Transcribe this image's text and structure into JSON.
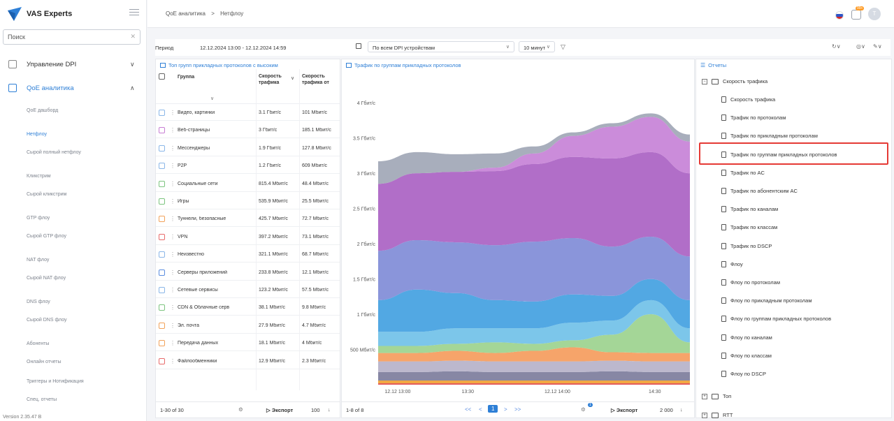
{
  "brand": {
    "name": "VAS Experts"
  },
  "search": {
    "placeholder": "Поиск"
  },
  "sidebar": {
    "sections": [
      {
        "label": "Управление DPI"
      },
      {
        "label": "QoE аналитика"
      }
    ],
    "items": [
      {
        "label": "QoE дашборд"
      },
      {
        "label": "Нетфлоу"
      },
      {
        "label": "Сырой полный нетфлоу"
      },
      {
        "label": "Кликстрим"
      },
      {
        "label": "Сырой кликстрим"
      },
      {
        "label": "GTP флоу"
      },
      {
        "label": "Сырой GTP флоу"
      },
      {
        "label": "NAT флоу"
      },
      {
        "label": "Сырой NAT флоу"
      },
      {
        "label": "DNS флоу"
      },
      {
        "label": "Сырой DNS флоу"
      },
      {
        "label": "Абоненты"
      },
      {
        "label": "Онлайн отчеты"
      },
      {
        "label": "Триггеры и Нотификация"
      },
      {
        "label": "Спец. отчеты"
      }
    ],
    "version": "Version 2.35.47 B"
  },
  "breadcrumb": {
    "root": "QoE аналитика",
    "sep": ">",
    "current": "Нетфлоу"
  },
  "avatar": {
    "initial": "T"
  },
  "filters": {
    "period_label": "Период",
    "period_value": "12.12.2024 13:00 - 12.12.2024 14:59",
    "device": "По всем DPI устройствам",
    "interval": "10 минут"
  },
  "table": {
    "title": "Топ групп прикладных протоколов с высоким",
    "columns": [
      "Группа",
      "Скорость трафика",
      "Скорость трафика от"
    ],
    "rows": [
      {
        "group": "Видео, картинки",
        "speed": "3.1 Гбит/с",
        "speed_from": "101 Мбит/с"
      },
      {
        "group": "Веб-страницы",
        "speed": "3 Гбит/с",
        "speed_from": "185.1 Мбит/с"
      },
      {
        "group": "Мессенджеры",
        "speed": "1.9 Гбит/с",
        "speed_from": "127.8 Мбит/с"
      },
      {
        "group": "P2P",
        "speed": "1.2 Гбит/с",
        "speed_from": "609 Мбит/с"
      },
      {
        "group": "Социальные сети",
        "speed": "815.4 Мбит/с",
        "speed_from": "48.4 Мбит/с"
      },
      {
        "group": "Игры",
        "speed": "535.9 Мбит/с",
        "speed_from": "25.5 Мбит/с"
      },
      {
        "group": "Туннели, безопасные",
        "speed": "425.7 Мбит/с",
        "speed_from": "72.7 Мбит/с"
      },
      {
        "group": "VPN",
        "speed": "397.2 Мбит/с",
        "speed_from": "73.1 Мбит/с"
      },
      {
        "group": "Неизвестно",
        "speed": "321.1 Мбит/с",
        "speed_from": "68.7 Мбит/с"
      },
      {
        "group": "Серверы приложений",
        "speed": "233.8 Мбит/с",
        "speed_from": "12.1 Мбит/с"
      },
      {
        "group": "Сетевые сервисы",
        "speed": "123.2 Мбит/с",
        "speed_from": "57.5 Мбит/с"
      },
      {
        "group": "CDN & Облачные серв",
        "speed": "38.1 Мбит/с",
        "speed_from": "9.8 Мбит/с"
      },
      {
        "group": "Эл. почта",
        "speed": "27.9 Мбит/с",
        "speed_from": "4.7 Мбит/с"
      },
      {
        "group": "Передача данных",
        "speed": "18.1 Мбит/с",
        "speed_from": "4 Мбит/с"
      },
      {
        "group": "Файлообменники",
        "speed": "12.9 Мбит/с",
        "speed_from": "2.3 Мбит/с"
      }
    ],
    "checkbox_colors": [
      "#8ab6e8",
      "#c77dd4",
      "#8ab6e8",
      "#8ab6e8",
      "#7cc47f",
      "#7cc47f",
      "#f2a25a",
      "#e86b6b",
      "#8ab6e8",
      "#5b8de0",
      "#8ab6e8",
      "#7cc47f",
      "#f2a25a",
      "#f2a25a",
      "#e86b6b"
    ],
    "footer": {
      "range": "1-30 of 30",
      "export": "Экспорт",
      "page_size": "100"
    }
  },
  "chart": {
    "title": "Трафик по группам прикладных протоколов",
    "footer": {
      "range": "1-8 of 8",
      "page": "1",
      "badge": "1",
      "export": "Экспорт",
      "page_size": "2 000"
    }
  },
  "chart_data": {
    "type": "area",
    "title": "Трафик по группам прикладных протоколов",
    "y_ticks": [
      "4 Гбит/с",
      "3.5 Гбит/с",
      "3 Гбит/с",
      "2.5 Гбит/с",
      "2 Гбит/с",
      "1.5 Гбит/с",
      "1 Гбит/с",
      "500 Мбит/с"
    ],
    "x_ticks": [
      "12.12 13:00",
      "13:30",
      "12.12 14:00",
      "14:30"
    ],
    "ylim": [
      0,
      4.2
    ],
    "x": [
      0,
      1,
      2,
      3,
      4,
      5,
      6,
      7,
      8
    ],
    "series": [
      {
        "color": "#e24a4a",
        "values": [
          0.02,
          0.02,
          0.02,
          0.02,
          0.02,
          0.02,
          0.02,
          0.02,
          0.02
        ]
      },
      {
        "color": "#f0a030",
        "values": [
          0.04,
          0.04,
          0.04,
          0.04,
          0.04,
          0.04,
          0.04,
          0.04,
          0.04
        ]
      },
      {
        "color": "#7a7a9a",
        "values": [
          0.12,
          0.12,
          0.13,
          0.12,
          0.12,
          0.12,
          0.13,
          0.12,
          0.12
        ]
      },
      {
        "color": "#b5b0c8",
        "values": [
          0.15,
          0.15,
          0.15,
          0.15,
          0.15,
          0.15,
          0.15,
          0.15,
          0.15
        ]
      },
      {
        "color": "#f59a5a",
        "values": [
          0.12,
          0.12,
          0.14,
          0.12,
          0.15,
          0.2,
          0.12,
          0.12,
          0.12
        ]
      },
      {
        "color": "#9ad18c",
        "values": [
          0.1,
          0.1,
          0.1,
          0.15,
          0.1,
          0.1,
          0.25,
          0.55,
          0.15
        ]
      },
      {
        "color": "#6ec0e8",
        "values": [
          0.2,
          0.2,
          0.22,
          0.2,
          0.22,
          0.25,
          0.2,
          0.2,
          0.2
        ]
      },
      {
        "color": "#3f9ee0",
        "values": [
          0.45,
          0.6,
          0.5,
          0.4,
          0.38,
          0.4,
          0.35,
          0.3,
          0.4
        ]
      },
      {
        "color": "#7d8ad6",
        "values": [
          0.7,
          0.7,
          0.72,
          0.78,
          0.85,
          0.8,
          0.7,
          0.6,
          0.62
        ]
      },
      {
        "color": "#a85ec2",
        "values": [
          0.95,
          0.95,
          1.0,
          1.05,
          1.1,
          1.15,
          1.25,
          1.2,
          1.18
        ]
      },
      {
        "color": "#c57fd6",
        "values": [
          0.0,
          0.0,
          0.0,
          0.05,
          0.15,
          0.3,
          0.45,
          0.5,
          0.45
        ]
      },
      {
        "color": "#9ea5b5",
        "values": [
          0.32,
          0.3,
          0.25,
          0.2,
          0.1,
          0.05,
          0.05,
          0.05,
          0.1
        ]
      }
    ]
  },
  "reports": {
    "title": "Отчеты",
    "folder": "Скорость трафика",
    "items": [
      {
        "label": "Скорость трафика"
      },
      {
        "label": "Трафик по протоколам"
      },
      {
        "label": "Трафик по прикладным протоколам"
      },
      {
        "label": "Трафик по группам прикладных протоколов"
      },
      {
        "label": "Трафик по AC"
      },
      {
        "label": "Трафик по абонентским AC"
      },
      {
        "label": "Трафик по каналам"
      },
      {
        "label": "Трафик по классам"
      },
      {
        "label": "Трафик по DSCP"
      },
      {
        "label": "Флоу"
      },
      {
        "label": "Флоу по протоколам"
      },
      {
        "label": "Флоу по прикладным протоколам"
      },
      {
        "label": "Флоу по группам прикладных протоколов"
      },
      {
        "label": "Флоу по каналам"
      },
      {
        "label": "Флоу по классам"
      },
      {
        "label": "Флоу по DSCP"
      }
    ],
    "folders": [
      {
        "label": "Топ"
      },
      {
        "label": "RTT"
      }
    ]
  }
}
